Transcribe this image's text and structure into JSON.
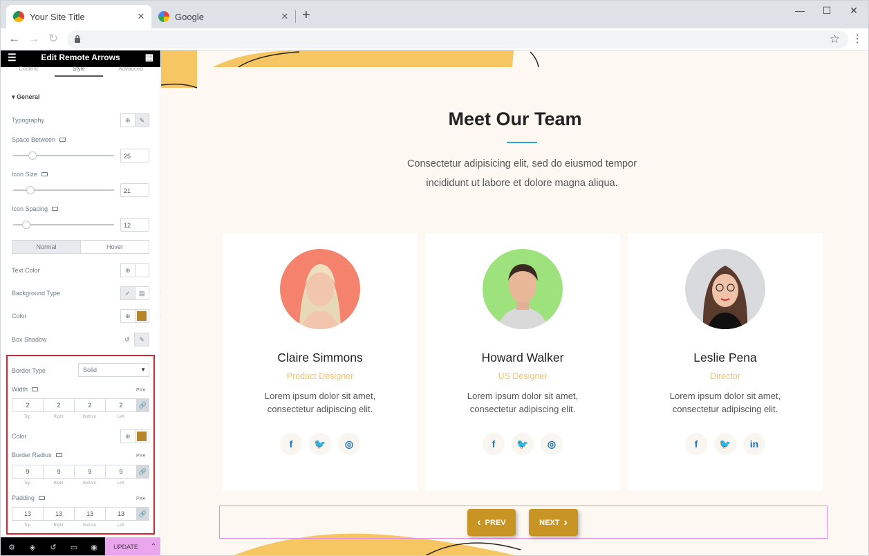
{
  "browser": {
    "tabs": [
      {
        "title": "Your Site Title"
      },
      {
        "title": "Google"
      }
    ],
    "close_symbol": "✕",
    "new_tab_symbol": "+",
    "window_controls": {
      "minimize": "—",
      "maximize": "☐",
      "close": "✕"
    }
  },
  "editor": {
    "title": "Edit Remote Arrows",
    "tabs": [
      "Content",
      "Style",
      "Advanced"
    ],
    "section": "General",
    "typography_label": "Typography",
    "space_between": {
      "label": "Space Between",
      "value": "25",
      "level": 0.12
    },
    "icon_size": {
      "label": "Icon Size",
      "value": "21",
      "level": 0.1
    },
    "icon_spacing": {
      "label": "Icon Spacing",
      "value": "12",
      "level": 0.05
    },
    "state_tabs": {
      "normal": "Normal",
      "hover": "Hover"
    },
    "text_color_label": "Text Color",
    "background_type_label": "Background Type",
    "color_label": "Color",
    "box_shadow_label": "Box Shadow",
    "border_type": {
      "label": "Border Type",
      "value": "Solid"
    },
    "width": {
      "label": "Width",
      "unit": "PX",
      "values": [
        "2",
        "2",
        "2",
        "2"
      ]
    },
    "border_color_label": "Color",
    "border_radius": {
      "label": "Border Radius",
      "unit": "PX",
      "values": [
        "9",
        "9",
        "9",
        "9"
      ]
    },
    "padding": {
      "label": "Padding",
      "unit": "PX",
      "values": [
        "13",
        "13",
        "13",
        "13"
      ]
    },
    "sides": [
      "Top",
      "Right",
      "Bottom",
      "Left"
    ],
    "update_label": "UPDATE",
    "accent_color": "#b5872a"
  },
  "page": {
    "title": "Meet Our Team",
    "intro_line1": "Consectetur adipisicing elit, sed do eiusmod tempor",
    "intro_line2": "incididunt ut labore et dolore magna aliqua.",
    "members": [
      {
        "name": "Claire Simmons",
        "role": "Product Designer",
        "desc1": "Lorem ipsum dolor sit amet,",
        "desc2": "consectetur adipiscing elit.",
        "bg": "#f4826d",
        "socials": [
          "f",
          "t",
          "ig"
        ]
      },
      {
        "name": "Howard Walker",
        "role": "US Designer",
        "desc1": "Lorem ipsum dolor sit amet,",
        "desc2": "consectetur adipiscing elit.",
        "bg": "#9ee27e",
        "socials": [
          "f",
          "t",
          "ig"
        ]
      },
      {
        "name": "Leslie Pena",
        "role": "Director",
        "desc1": "Lorem ipsum dolor sit amet,",
        "desc2": "consectetur adipiscing elit.",
        "bg": "#d8dadd",
        "socials": [
          "f",
          "t",
          "in"
        ]
      }
    ],
    "prev_label": "PREV",
    "next_label": "NEXT",
    "button_color": "#c89524"
  }
}
